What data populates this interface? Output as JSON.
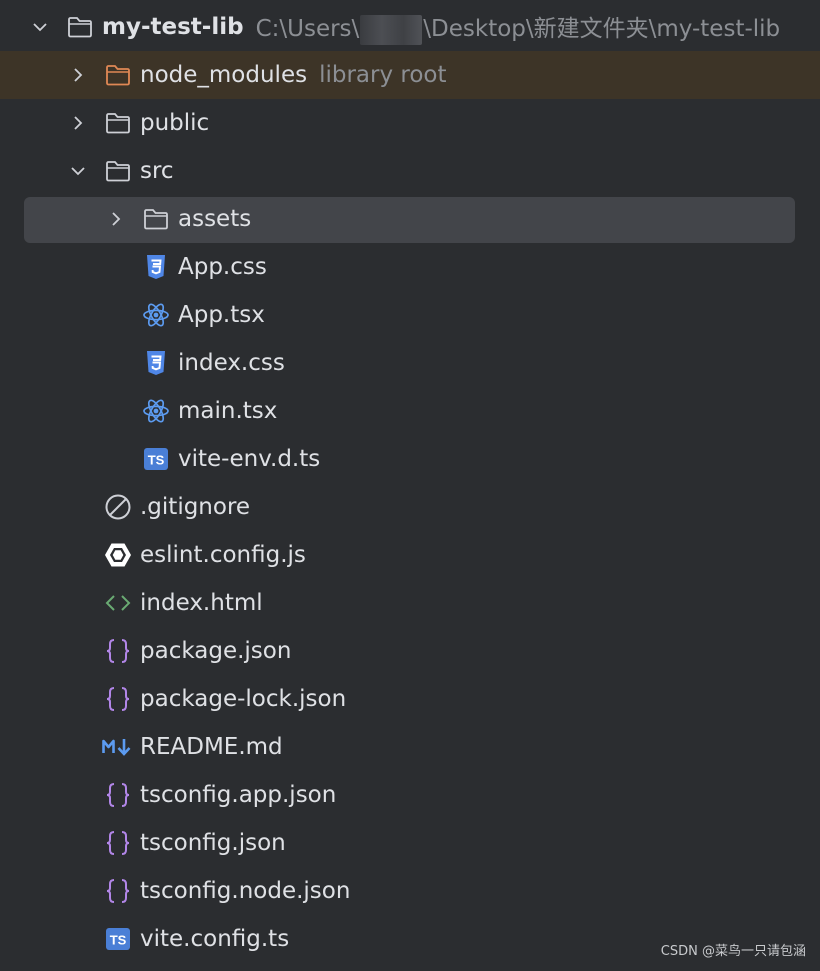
{
  "root": {
    "name": "my-test-lib",
    "path_prefix": "C:\\Users\\",
    "path_suffix": "\\Desktop\\新建文件夹\\my-test-lib"
  },
  "items": [
    {
      "name": "node_modules",
      "hint": "library root",
      "icon": "folder-excluded-icon"
    },
    {
      "name": "public",
      "icon": "folder-icon"
    },
    {
      "name": "src",
      "icon": "folder-icon"
    },
    {
      "name": "assets",
      "icon": "folder-icon"
    },
    {
      "name": "App.css",
      "icon": "css-file-icon"
    },
    {
      "name": "App.tsx",
      "icon": "react-file-icon"
    },
    {
      "name": "index.css",
      "icon": "css-file-icon"
    },
    {
      "name": "main.tsx",
      "icon": "react-file-icon"
    },
    {
      "name": "vite-env.d.ts",
      "icon": "typescript-file-icon"
    },
    {
      "name": ".gitignore",
      "icon": "ignore-file-icon"
    },
    {
      "name": "eslint.config.js",
      "icon": "eslint-file-icon"
    },
    {
      "name": "index.html",
      "icon": "html-file-icon"
    },
    {
      "name": "package.json",
      "icon": "json-file-icon"
    },
    {
      "name": "package-lock.json",
      "icon": "json-file-icon"
    },
    {
      "name": "README.md",
      "icon": "markdown-file-icon"
    },
    {
      "name": "tsconfig.app.json",
      "icon": "json-file-icon"
    },
    {
      "name": "tsconfig.json",
      "icon": "json-file-icon"
    },
    {
      "name": "tsconfig.node.json",
      "icon": "json-file-icon"
    },
    {
      "name": "vite.config.ts",
      "icon": "typescript-file-icon"
    }
  ],
  "watermark": "CSDN @菜鸟一只请包涵",
  "colors": {
    "background": "#2b2d30",
    "excluded_row": "#3d3427",
    "selected_row": "#43454a",
    "css_icon": "#4f86e6",
    "react_icon": "#5c9bf0",
    "ts_icon": "#4a7fd6",
    "json_icon": "#b286e8",
    "html_icon": "#6aab73",
    "excluded_folder": "#e08855"
  }
}
